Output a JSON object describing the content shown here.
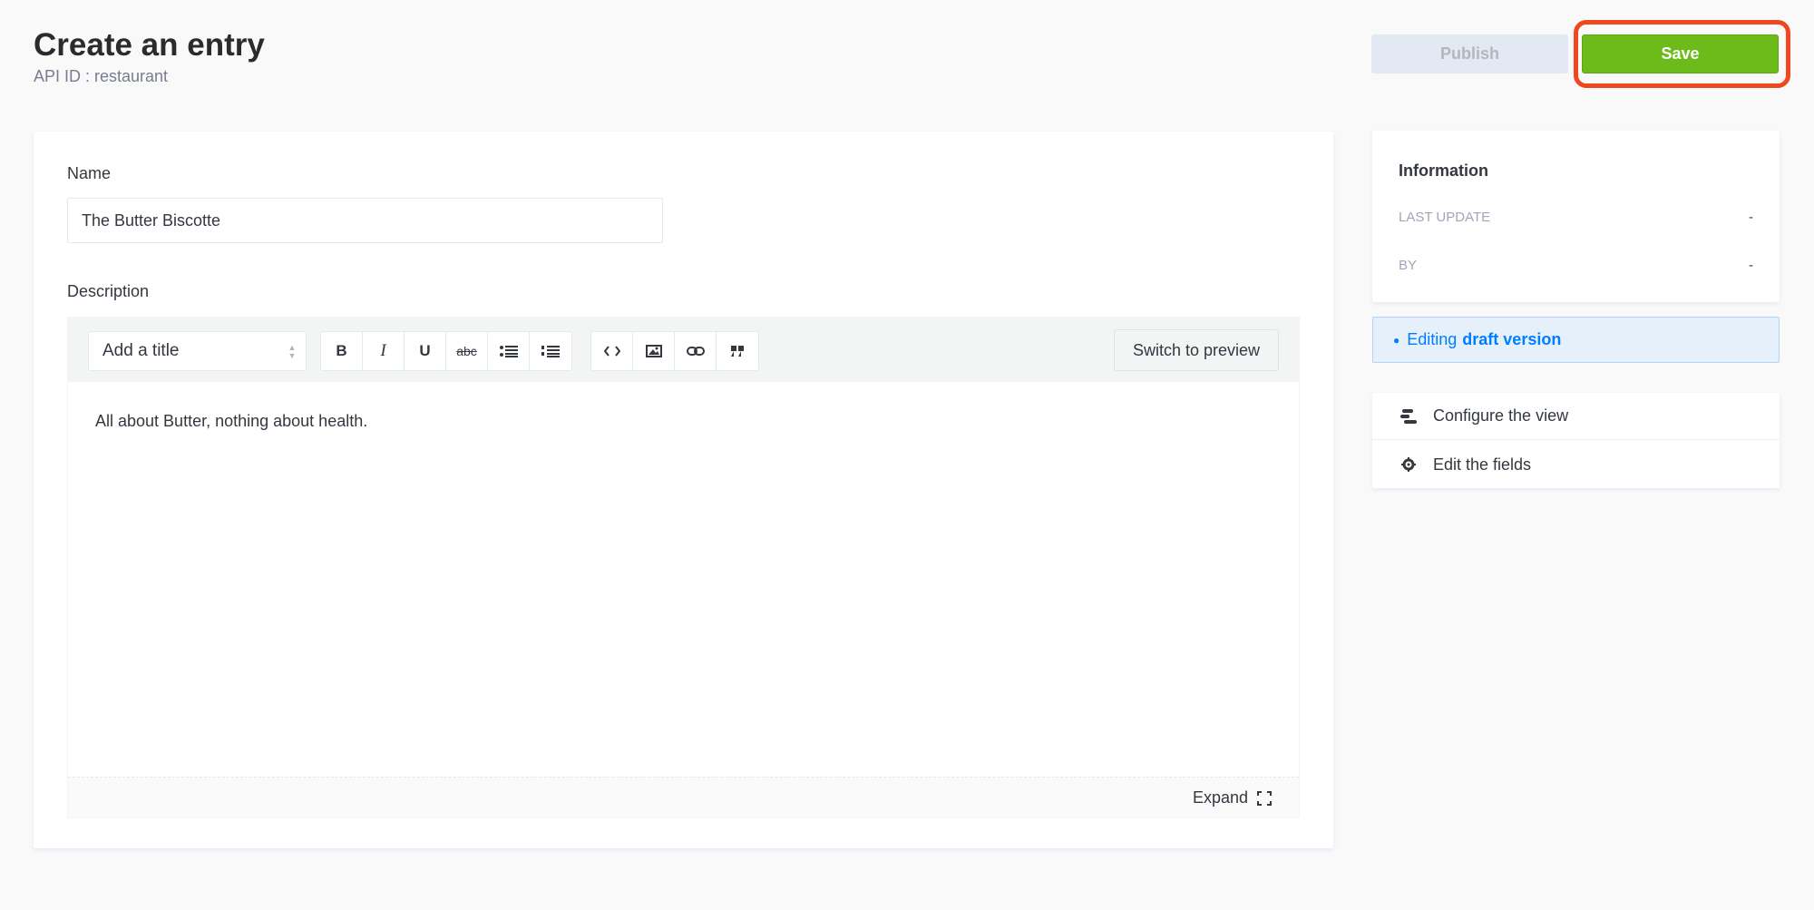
{
  "header": {
    "title": "Create an entry",
    "subtitle": "API ID : restaurant",
    "publish_label": "Publish",
    "save_label": "Save"
  },
  "form": {
    "name": {
      "label": "Name",
      "value": "The Butter Biscotte"
    },
    "description": {
      "label": "Description",
      "title_select": "Add a title",
      "toolbar_group1": [
        {
          "icon": "bold-icon",
          "glyph": "B"
        },
        {
          "icon": "italic-icon",
          "glyph": "I"
        },
        {
          "icon": "underline-icon",
          "glyph": "U"
        },
        {
          "icon": "strikethrough-icon",
          "glyph": "abc"
        },
        {
          "icon": "bulleted-list-icon",
          "glyph": ""
        },
        {
          "icon": "numbered-list-icon",
          "glyph": ""
        }
      ],
      "toolbar_group2": [
        {
          "icon": "code-icon"
        },
        {
          "icon": "image-icon"
        },
        {
          "icon": "link-icon"
        },
        {
          "icon": "quote-icon"
        }
      ],
      "switch_label": "Switch to preview",
      "content": "All about Butter, nothing about health.",
      "expand_label": "Expand"
    }
  },
  "sidebar": {
    "info_title": "Information",
    "rows": [
      {
        "label": "LAST UPDATE",
        "value": "-"
      },
      {
        "label": "BY",
        "value": "-"
      }
    ],
    "draft": {
      "prefix": "Editing",
      "emphasis": "draft version"
    },
    "links": [
      {
        "label": "Configure the view",
        "icon": "layout-icon"
      },
      {
        "label": "Edit the fields",
        "icon": "gear-icon"
      }
    ]
  },
  "colors": {
    "save": "#6dbb1a",
    "highlight": "#f0481e",
    "draft_text": "#007eff"
  }
}
